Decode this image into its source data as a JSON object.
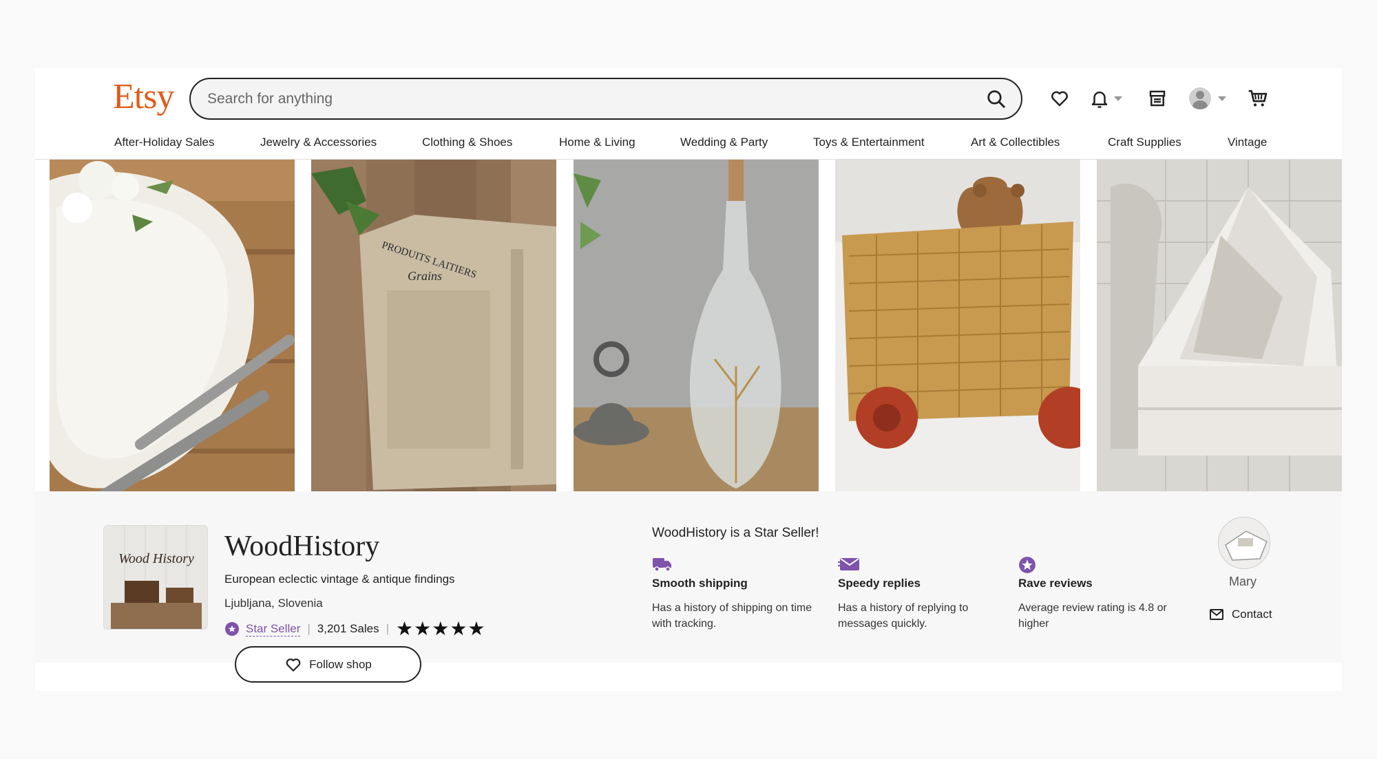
{
  "header": {
    "logo": "Etsy",
    "search_placeholder": "Search for anything",
    "icons": [
      "search-icon",
      "heart-icon",
      "bell-icon",
      "shop-icon",
      "user-avatar-icon",
      "cart-icon"
    ]
  },
  "nav": {
    "items": [
      "After-Holiday Sales",
      "Jewelry & Accessories",
      "Clothing & Shoes",
      "Home & Living",
      "Wedding & Party",
      "Toys & Entertainment",
      "Art & Collectibles",
      "Craft Supplies",
      "Vintage"
    ]
  },
  "banner": {
    "panels": [
      "white-plate-with-forks",
      "linen-grain-sack",
      "glass-bottle-with-dried-flowers",
      "wicker-basket-cart-with-teddy-bear",
      "white-wooden-box"
    ],
    "sack_text_line1": "PRODUITS LAITIERS",
    "sack_text_line2": "Grains"
  },
  "shop": {
    "logo_text": "Wood History",
    "name": "WoodHistory",
    "tagline": "European eclectic vintage & antique findings",
    "location": "Ljubljana, Slovenia",
    "star_seller_label": "Star Seller",
    "sales": "3,201 Sales",
    "rating_stars": 5,
    "stars_display": "★★★★★",
    "follow_label": "Follow shop"
  },
  "star_seller": {
    "title": "WoodHistory is a Star Seller!",
    "items": [
      {
        "icon": "truck-icon",
        "heading": "Smooth shipping",
        "description": "Has a history of shipping on time with tracking."
      },
      {
        "icon": "envelope-icon",
        "heading": "Speedy replies",
        "description": "Has a history of replying to messages quickly."
      },
      {
        "icon": "star-badge-icon",
        "heading": "Rave reviews",
        "description": "Average review rating is 4.8 or higher"
      }
    ]
  },
  "owner": {
    "name": "Mary",
    "contact_label": "Contact"
  },
  "colors": {
    "brand": "#e15b1a",
    "star_seller": "#7f53ac",
    "text": "#222222"
  }
}
